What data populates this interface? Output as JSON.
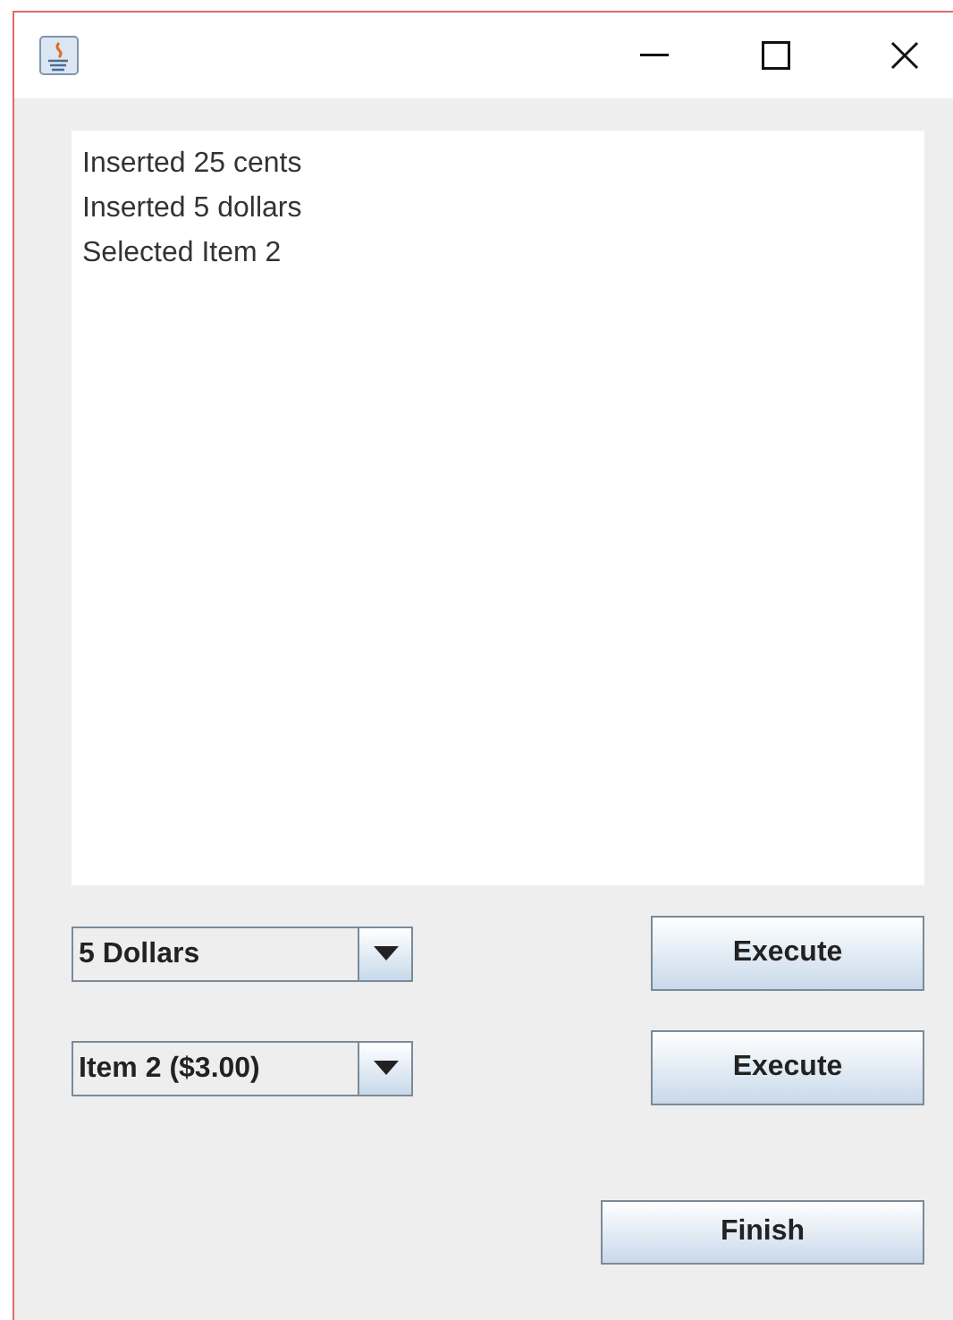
{
  "log": {
    "lines": [
      "Inserted 25 cents",
      "Inserted 5 dollars",
      "Selected Item 2"
    ]
  },
  "rows": [
    {
      "combo": {
        "value": "5 Dollars"
      },
      "button": "Execute"
    },
    {
      "combo": {
        "value": "Item 2 ($3.00)"
      },
      "button": "Execute"
    }
  ],
  "finish_button": "Finish"
}
